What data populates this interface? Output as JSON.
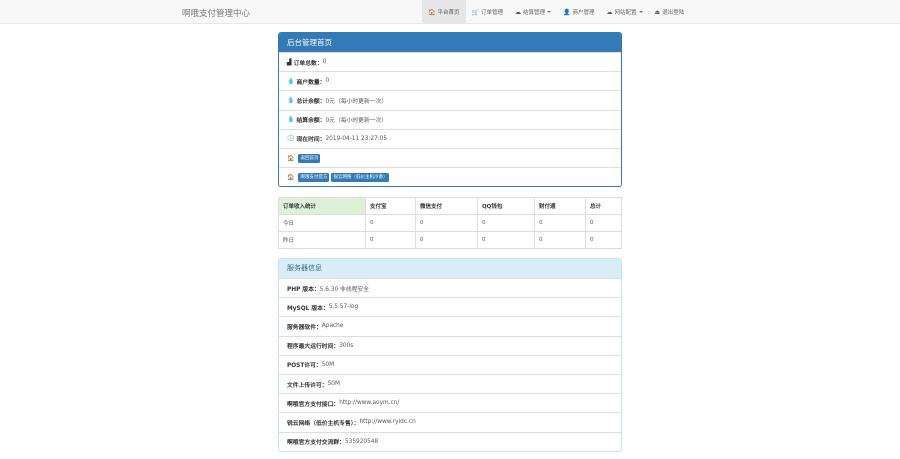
{
  "navbar": {
    "brand": "啊哦支付管理中心",
    "items": [
      {
        "icon": "home-icon",
        "glyph": "🏠",
        "label": "平台首页",
        "active": true,
        "dropdown": false
      },
      {
        "icon": "cart-icon",
        "glyph": "🛒",
        "label": "订单管理",
        "active": false,
        "dropdown": false
      },
      {
        "icon": "cloud-icon",
        "glyph": "☁",
        "label": "结算管理",
        "active": false,
        "dropdown": true
      },
      {
        "icon": "user-icon",
        "glyph": "👤",
        "label": "商户管理",
        "active": false,
        "dropdown": false
      },
      {
        "icon": "cloud-icon",
        "glyph": "☁",
        "label": "网站配置",
        "active": false,
        "dropdown": true
      },
      {
        "icon": "logout-icon",
        "glyph": "⏏",
        "label": "退出登陆",
        "active": false,
        "dropdown": false
      }
    ]
  },
  "admin_panel": {
    "title": "后台管理首页",
    "rows": [
      {
        "icon": "bar-chart-icon",
        "glyph": "▟",
        "label": "订单总数：",
        "value": "0"
      },
      {
        "icon": "tint-icon",
        "glyph": "💧",
        "label": "商户数量：",
        "value": "0"
      },
      {
        "icon": "tint-icon",
        "glyph": "💧",
        "label": "总计余额：",
        "value": "0元（每小时更新一次）"
      },
      {
        "icon": "tint-icon",
        "glyph": "💧",
        "label": "结算余额：",
        "value": "0元（每小时更新一次）"
      },
      {
        "icon": "clock-icon",
        "glyph": "🕓",
        "label": "现在时间：",
        "value": "2019-04-11 23:27:05"
      }
    ],
    "home_row": {
      "icon": "home-icon",
      "glyph": "🏠",
      "button": "返回首页"
    },
    "links_row": {
      "icon": "home-icon",
      "glyph": "🏠",
      "buttons": [
        "啊哦支付官方",
        "锐云网络（低价主机冷香）"
      ]
    }
  },
  "stats_table": {
    "headers": [
      "订单收入统计",
      "支付宝",
      "微信支付",
      "QQ钱包",
      "财付通",
      "总计"
    ],
    "rows": [
      [
        "今日",
        "0",
        "0",
        "0",
        "0",
        "0"
      ],
      [
        "昨日",
        "0",
        "0",
        "0",
        "0",
        "0"
      ]
    ]
  },
  "server_panel": {
    "title": "服务器信息",
    "rows": [
      {
        "label": "PHP 版本：",
        "value": "5.6.30 非线程安全"
      },
      {
        "label": "MySQL 版本：",
        "value": "5.5.57-log"
      },
      {
        "label": "服务器软件：",
        "value": "Apache"
      },
      {
        "label": "程序最大运行时间：",
        "value": "300s"
      },
      {
        "label": "POST许可：",
        "value": "50M"
      },
      {
        "label": "文件上传许可：",
        "value": "50M"
      },
      {
        "label": "啊哦官方支付接口：",
        "value": "http://www.aoym.cn/"
      },
      {
        "label": "锐云网络（低价主机专售）：",
        "value": "http://www.ryidc.cn"
      },
      {
        "label": "啊哦官方支付交流群：",
        "value": "535920548"
      }
    ]
  }
}
